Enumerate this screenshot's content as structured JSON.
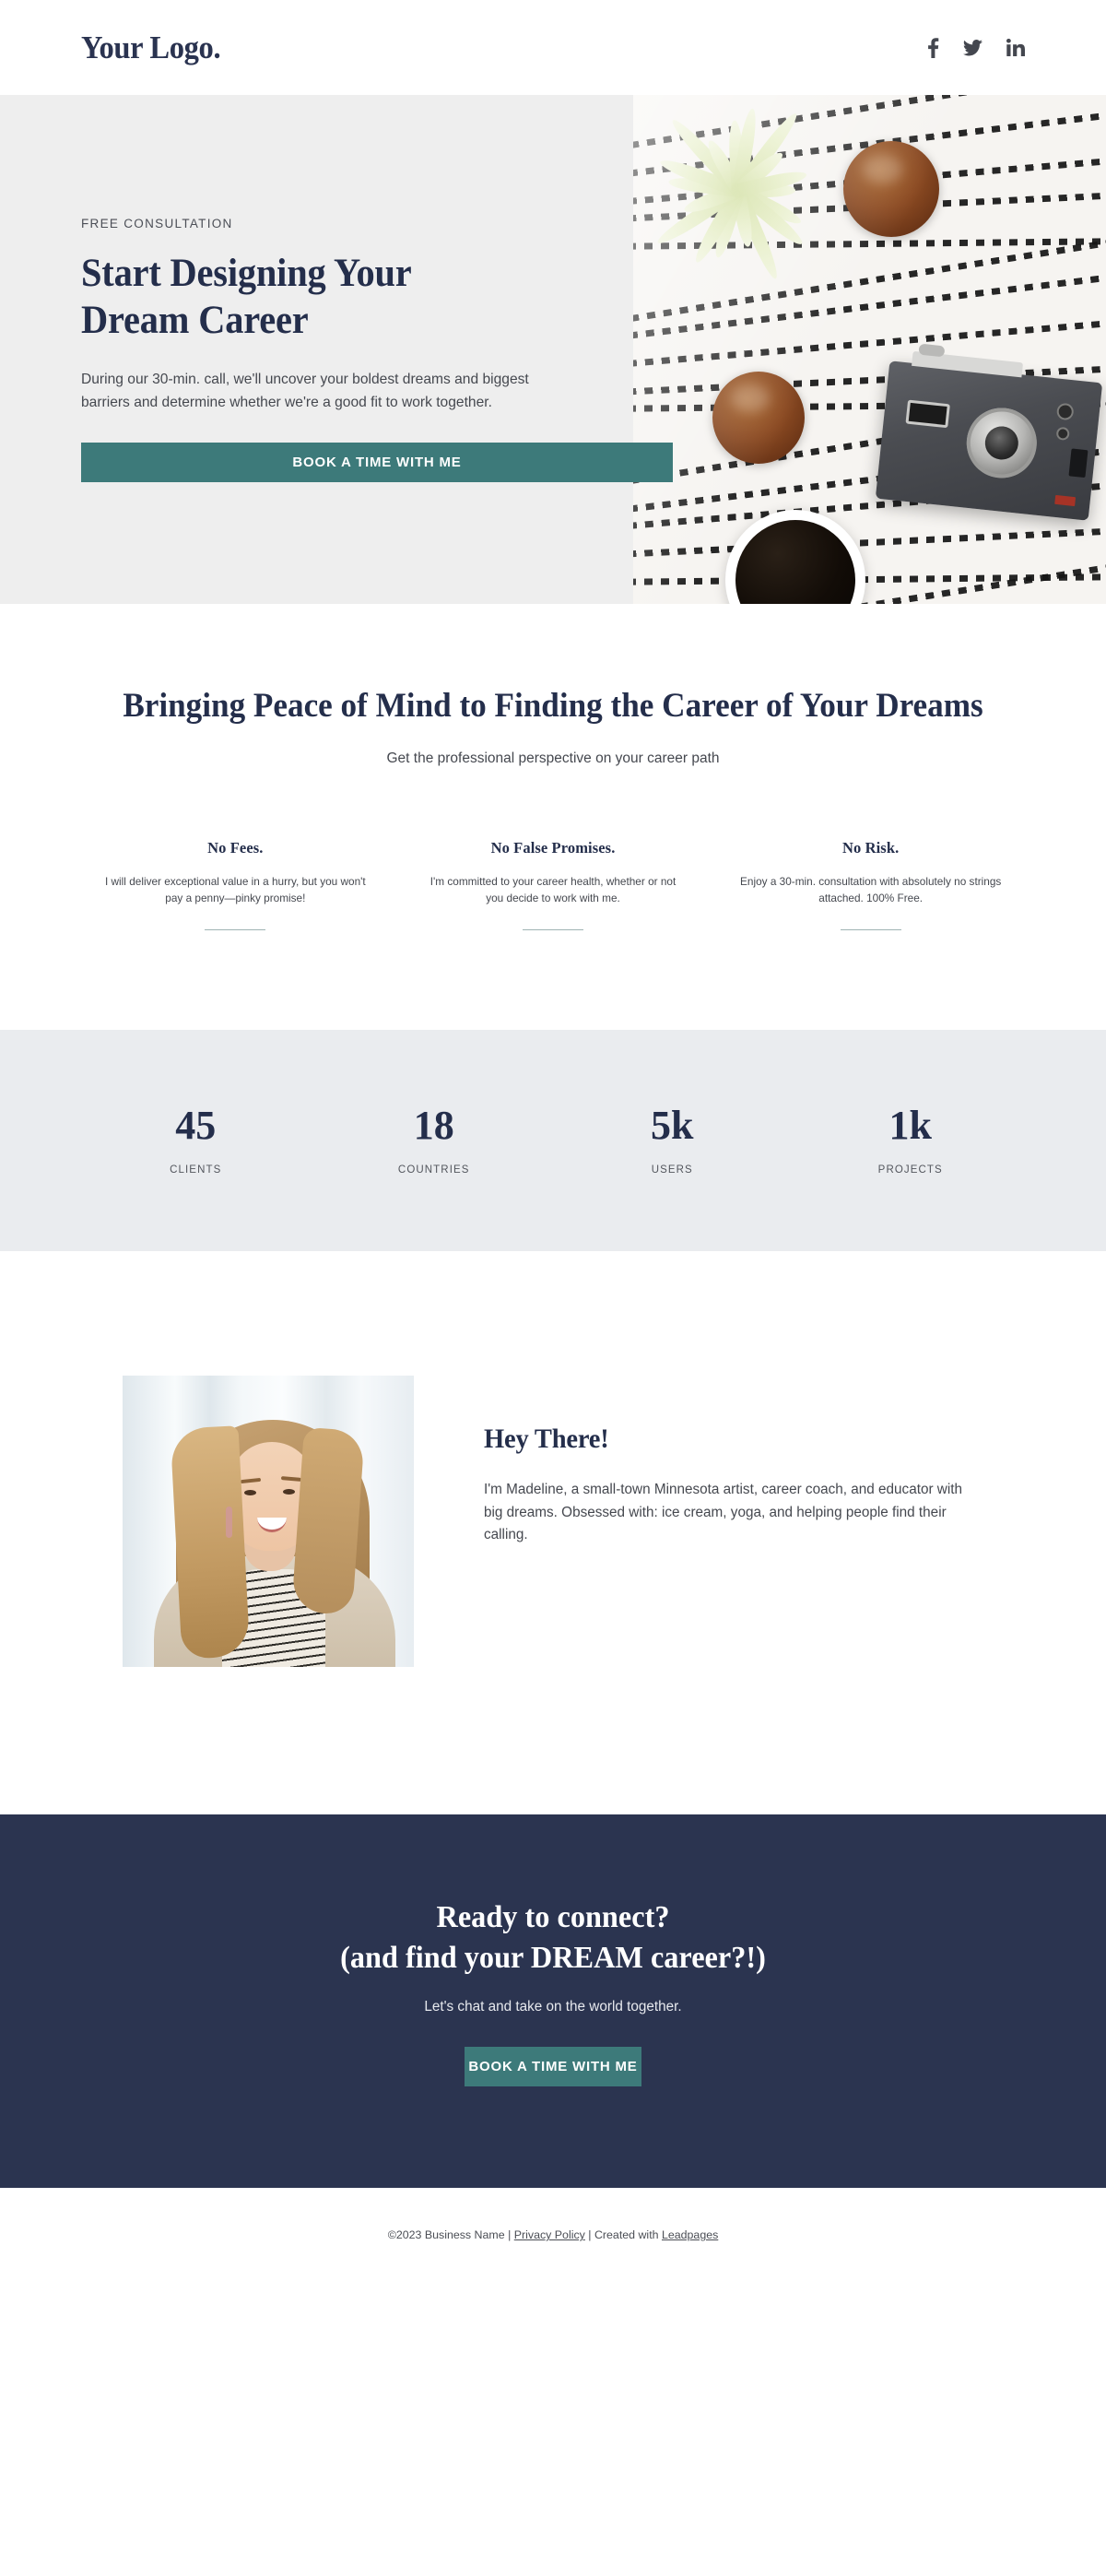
{
  "header": {
    "logo": "Your Logo.",
    "social": [
      {
        "name": "facebook-icon",
        "label": "Facebook"
      },
      {
        "name": "twitter-icon",
        "label": "Twitter"
      },
      {
        "name": "linkedin-icon",
        "label": "LinkedIn"
      }
    ]
  },
  "hero": {
    "eyebrow": "FREE CONSULTATION",
    "title_line1": "Start Designing Your",
    "title_line2": "Dream Career",
    "body": "During our 30-min. call, we'll uncover your boldest dreams and biggest barriers and determine whether we're a good fit to work together.",
    "cta_label": "BOOK A TIME WITH ME",
    "image_alt": "Flat lay photo of a plant, two wooden bowls, a vintage camera and a cup of black coffee on a black and white striped cloth"
  },
  "promise": {
    "title": "Bringing Peace of Mind to Finding the Career of Your Dreams",
    "subtitle": "Get the professional perspective on your career path",
    "features": [
      {
        "title": "No Fees.",
        "body": "I will deliver exceptional value in a hurry, but you won't pay a penny—pinky promise!"
      },
      {
        "title": "No False Promises.",
        "body": "I'm committed to your career health, whether or not you decide to work with me."
      },
      {
        "title": "No Risk.",
        "body": "Enjoy a 30-min. consultation with absolutely no strings attached. 100% Free."
      }
    ]
  },
  "stats": [
    {
      "value": "45",
      "label": "CLIENTS"
    },
    {
      "value": "18",
      "label": "COUNTRIES"
    },
    {
      "value": "5k",
      "label": "USERS"
    },
    {
      "value": "1k",
      "label": "PROJECTS"
    }
  ],
  "about": {
    "title": "Hey There!",
    "body": "I'm Madeline, a small-town Minnesota artist, career coach, and educator with big dreams. Obsessed with: ice cream, yoga, and helping people find their calling.",
    "portrait_alt": "Smiling woman with long blonde hair wearing a beige cardigan over a striped top"
  },
  "cta": {
    "title_line1": "Ready to connect?",
    "title_line2": "(and find your DREAM career?!)",
    "subtitle": "Let's chat and take on the world together.",
    "button_label": "BOOK A TIME WITH ME"
  },
  "footer": {
    "copyright": "©2023 Business Name",
    "separator1": " | ",
    "privacy_link": "Privacy Policy",
    "separator2": " | Created with ",
    "platform_link": "Leadpages"
  },
  "colors": {
    "navy": "#2b3450",
    "teal": "#3d7a7a",
    "hero_bg": "#eeeeee",
    "stats_bg": "#eaecef"
  }
}
